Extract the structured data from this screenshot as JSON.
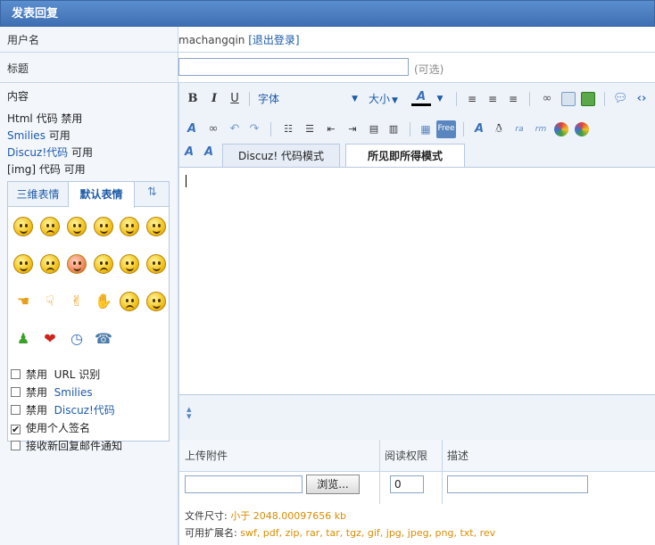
{
  "title": "发表回复",
  "username_row": {
    "label": "用户名",
    "username": "machangqin",
    "logout_open": "[",
    "logout": "退出登录",
    "logout_close": "]"
  },
  "subject_row": {
    "label": "标题",
    "value": "",
    "optional": "(可选)"
  },
  "content_row": {
    "label": "内容",
    "html_label": "Html 代码",
    "html_status": "禁用",
    "smilies_label": "Smilies",
    "smilies_status": "可用",
    "discuz_label": "Discuz!代码",
    "discuz_status": "可用",
    "img_label": "[img] 代码",
    "img_status": "可用"
  },
  "smilies_panel": {
    "tabs": [
      "三维表情",
      "默认表情"
    ],
    "active_tab": "默认表情",
    "icons": [
      "smile-icon",
      "sad-icon",
      "tongue-icon",
      "wink-icon",
      "laugh-icon",
      "blink-icon",
      "yawn-icon",
      "shy-icon",
      "scream-icon",
      "cry-icon",
      "confused-icon",
      "whistle-icon",
      "hand-left-icon",
      "hand-down-icon",
      "victory-icon",
      "handshake-icon",
      "angry-icon",
      "grin-icon",
      "person-icon",
      "lips-icon",
      "clock-icon",
      "phone-icon"
    ]
  },
  "options": [
    {
      "checked": false,
      "prefix": "禁用",
      "label": "URL 识别",
      "link": false
    },
    {
      "checked": false,
      "prefix": "禁用",
      "label": "Smilies",
      "link": true
    },
    {
      "checked": false,
      "prefix": "禁用",
      "label": "Discuz!代码",
      "link": true
    },
    {
      "checked": true,
      "prefix": "",
      "label": "使用个人签名",
      "link": false
    },
    {
      "checked": false,
      "prefix": "",
      "label": "接收新回复邮件通知",
      "link": false
    }
  ],
  "editor": {
    "toolbar": {
      "bold": "B",
      "italic": "I",
      "underline": "U",
      "font": "字体",
      "size": "大小",
      "color_a": "A",
      "free": "Free"
    },
    "modes": [
      "Discuz! 代码模式",
      "所见即所得模式"
    ],
    "active_mode": "所见即所得模式",
    "content": ""
  },
  "attachments": {
    "col_upload": "上传附件",
    "col_perm": "阅读权限",
    "col_desc": "描述",
    "browse_label": "浏览...",
    "perm_value": "0",
    "filesize_label": "文件尺寸:",
    "filesize_value": "小于 2048.00097656 kb",
    "ext_label": "可用扩展名:",
    "ext_value": "swf, pdf, zip, rar, tar, tgz, gif, jpg, jpeg, png, txt, rev"
  },
  "colors": {
    "title_bar": "#4a7fc1",
    "link": "#1d5aa8",
    "accent_orange": "#d98c00"
  }
}
